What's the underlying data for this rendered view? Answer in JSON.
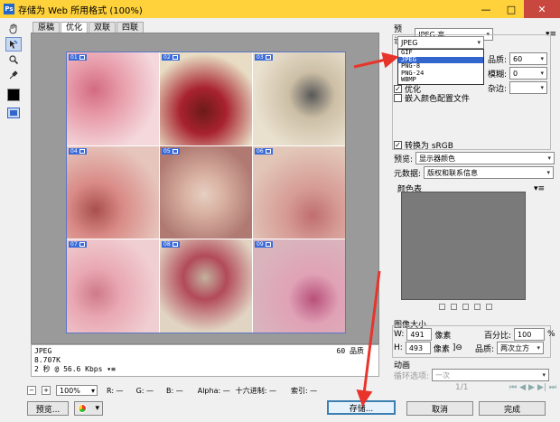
{
  "window": {
    "title": "存储为 Web 所用格式 (100%)",
    "controls": [
      "—",
      "□",
      "✕"
    ]
  },
  "tools": [
    "hand-icon",
    "slice-select-icon",
    "zoom-icon",
    "eyedropper-icon",
    "color-swatch",
    "toggle-slices-icon"
  ],
  "tabs": [
    "原稿",
    "优化",
    "双联",
    "四联"
  ],
  "slices": [
    {
      "num": "01",
      "colors": [
        "#f4d8dc",
        "#e79aa8",
        "#d36b82"
      ]
    },
    {
      "num": "02",
      "colors": [
        "#e8ddc4",
        "#a8222e",
        "#6c1a1a"
      ]
    },
    {
      "num": "03",
      "colors": [
        "#e9e0ce",
        "#cdbfa6",
        "#585858"
      ]
    },
    {
      "num": "04",
      "colors": [
        "#e6c5bc",
        "#d98a86",
        "#a84f4c"
      ]
    },
    {
      "num": "05",
      "colors": [
        "#b07a73",
        "#d8b0a0",
        "#e6cfc2"
      ]
    },
    {
      "num": "06",
      "colors": [
        "#e2c6b8",
        "#d69b95",
        "#bf6f6e"
      ]
    },
    {
      "num": "07",
      "colors": [
        "#f0cfd2",
        "#e9a8b3",
        "#cf7a8a"
      ]
    },
    {
      "num": "08",
      "colors": [
        "#e1d4c2",
        "#b24a5a",
        "#c3b19d"
      ]
    },
    {
      "num": "09",
      "colors": [
        "#d9b4bd",
        "#e0a2b6",
        "#b8507a"
      ]
    }
  ],
  "status": {
    "format": "JPEG",
    "size": "8.707K",
    "time": "2 秒 @ 56.6 Kbps",
    "quality": "60 品质"
  },
  "bottom": {
    "zoom": "100%",
    "r_label": "R: —",
    "g_label": "G: —",
    "b_label": "B: —",
    "alpha_label": "Alpha: —",
    "hex_label": "十六进制: —",
    "index_label": "索引: —"
  },
  "buttons": {
    "preview": "预览...",
    "save": "存储...",
    "cancel": "取消",
    "done": "完成"
  },
  "right": {
    "preset_label": "预设:",
    "preset_value": "JPEG 高",
    "format_value": "JPEG",
    "format_options": [
      "GIF",
      "JPEG",
      "PNG-8",
      "PNG-24",
      "WBMP"
    ],
    "selected_format": "JPEG",
    "quality_label": "品质:",
    "quality_value": "60",
    "blur_label": "模糊:",
    "blur_value": "0",
    "matte_label": "杂边:",
    "embed_profile": "嵌入颜色配置文件",
    "progressive_partial": "优化",
    "convert_srgb": "转换为 sRGB",
    "preview_label": "预览:",
    "preview_value": "显示器颜色",
    "metadata_label": "元数据:",
    "metadata_value": "版权和联系信息",
    "color_table_label": "颜色表",
    "image_size_label": "图像大小",
    "w_label": "W:",
    "w_value": "491",
    "h_label": "H:",
    "h_value": "493",
    "px_unit": "像素",
    "percent_label": "百分比:",
    "percent_value": "100",
    "percent_unit": "%",
    "resample_label": "品质:",
    "resample_value": "两次立方",
    "anim_label": "动画",
    "loop_label": "循环选项:",
    "loop_value": "一次",
    "frame_counter": "1/1"
  },
  "colors": {
    "accent": "#3366cc",
    "arrow": "#e8342a",
    "titlebar": "#ffd23c"
  }
}
